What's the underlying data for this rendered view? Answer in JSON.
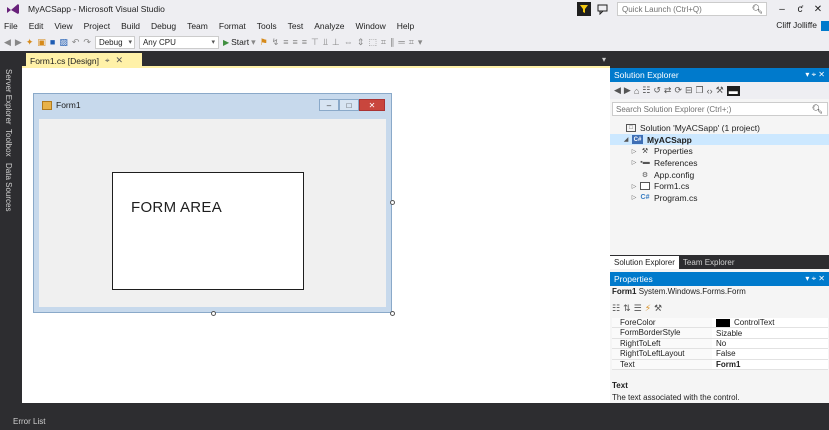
{
  "window": {
    "title": "MyACSapp - Microsoft Visual Studio",
    "quick_launch_placeholder": "Quick Launch (Ctrl+Q)",
    "user": "Cliff Jolliffe",
    "min": "–",
    "max": "ƈ",
    "close": "✕"
  },
  "menu": [
    "File",
    "Edit",
    "View",
    "Project",
    "Build",
    "Debug",
    "Team",
    "Format",
    "Tools",
    "Test",
    "Analyze",
    "Window",
    "Help"
  ],
  "toolbar": {
    "config": "Debug",
    "platform": "Any CPU",
    "start_label": "Start"
  },
  "side_tabs": [
    "Server Explorer",
    "Toolbox",
    "Data Sources"
  ],
  "designer": {
    "tab_label": "Form1.cs [Design]",
    "form_title": "Form1",
    "form_area_label": "FORM AREA"
  },
  "solution_explorer": {
    "header": "Solution Explorer",
    "search_placeholder": "Search Solution Explorer (Ctrl+;)",
    "items": [
      {
        "label": "Solution 'MyACSapp' (1 project)",
        "indent": 0,
        "expander": "",
        "icon": "solution-icon"
      },
      {
        "label": "MyACSapp",
        "indent": 1,
        "expander": "◢",
        "icon": "csharp-project-icon"
      },
      {
        "label": "Properties",
        "indent": 2,
        "expander": "▷",
        "icon": "wrench-icon"
      },
      {
        "label": "References",
        "indent": 2,
        "expander": "▷",
        "icon": "references-icon"
      },
      {
        "label": "App.config",
        "indent": 2,
        "expander": "",
        "icon": "config-file-icon"
      },
      {
        "label": "Form1.cs",
        "indent": 2,
        "expander": "▷",
        "icon": "form-file-icon"
      },
      {
        "label": "Program.cs",
        "indent": 2,
        "expander": "▷",
        "icon": "csharp-file-icon"
      }
    ],
    "tabs": [
      "Solution Explorer",
      "Team Explorer"
    ]
  },
  "properties": {
    "header": "Properties",
    "object_name": "Form1",
    "object_type": "System.Windows.Forms.Form",
    "rows": [
      {
        "name": "ForeColor",
        "value": "ControlText",
        "swatch": "#000000"
      },
      {
        "name": "FormBorderStyle",
        "value": "Sizable"
      },
      {
        "name": "RightToLeft",
        "value": "No"
      },
      {
        "name": "RightToLeftLayout",
        "value": "False"
      },
      {
        "name": "Text",
        "value": "Form1",
        "bold": true
      }
    ],
    "desc_name": "Text",
    "desc_text": "The text associated with the control."
  },
  "bottom_panel": {
    "label": "Error List"
  },
  "colors": {
    "accent": "#007acc",
    "chrome": "#2d2d30",
    "doc_tab": "#fff1a8"
  }
}
